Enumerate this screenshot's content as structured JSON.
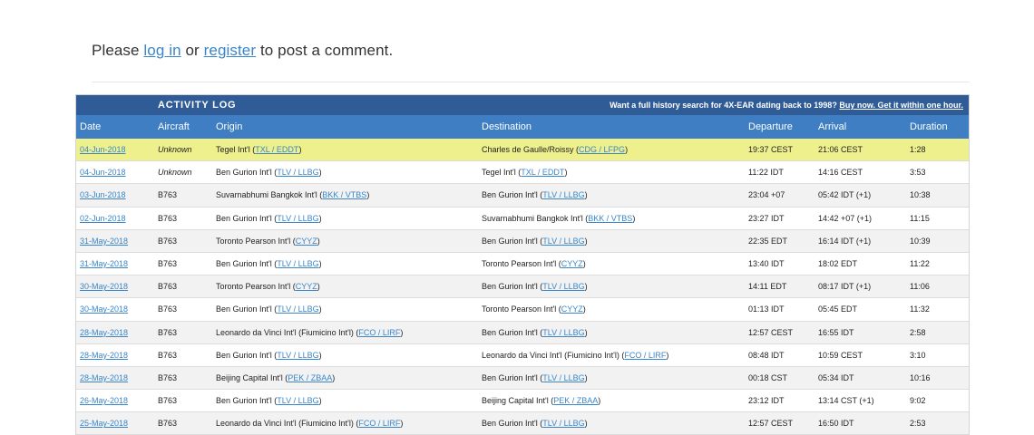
{
  "comment": {
    "prefix": "Please ",
    "login_label": "log in",
    "middle": " or ",
    "register_label": "register",
    "suffix": " to post a comment."
  },
  "activity_log": {
    "title": "ACTIVITY LOG",
    "promo_text": "Want a full history search for 4X-EAR dating back to 1998? ",
    "promo_link": "Buy now. Get it within one hour.",
    "columns": [
      "Date",
      "Aircraft",
      "Origin",
      "Destination",
      "Departure",
      "Arrival",
      "Duration"
    ],
    "rows": [
      {
        "date": "04-Jun-2018",
        "aircraft": "Unknown",
        "origin_name": "Tegel Int'l",
        "origin_code": "TXL / EDDT",
        "dest_name": "Charles de Gaulle/Roissy",
        "dest_code": "CDG / LFPG",
        "departure": "19:37 CEST",
        "arrival": "21:06 CEST",
        "duration": "1:28"
      },
      {
        "date": "04-Jun-2018",
        "aircraft": "Unknown",
        "origin_name": "Ben Gurion Int'l",
        "origin_code": "TLV / LLBG",
        "dest_name": "Tegel Int'l",
        "dest_code": "TXL / EDDT",
        "departure": "11:22 IDT",
        "arrival": "14:16 CEST",
        "duration": "3:53"
      },
      {
        "date": "03-Jun-2018",
        "aircraft": "B763",
        "origin_name": "Suvarnabhumi Bangkok Int'l",
        "origin_code": "BKK / VTBS",
        "dest_name": "Ben Gurion Int'l",
        "dest_code": "TLV / LLBG",
        "departure": "23:04 +07",
        "arrival": "05:42 IDT (+1)",
        "duration": "10:38"
      },
      {
        "date": "02-Jun-2018",
        "aircraft": "B763",
        "origin_name": "Ben Gurion Int'l",
        "origin_code": "TLV / LLBG",
        "dest_name": "Suvarnabhumi Bangkok Int'l",
        "dest_code": "BKK / VTBS",
        "departure": "23:27 IDT",
        "arrival": "14:42 +07 (+1)",
        "duration": "11:15"
      },
      {
        "date": "31-May-2018",
        "aircraft": "B763",
        "origin_name": "Toronto Pearson Int'l",
        "origin_code": "CYYZ",
        "dest_name": "Ben Gurion Int'l",
        "dest_code": "TLV / LLBG",
        "departure": "22:35 EDT",
        "arrival": "16:14 IDT (+1)",
        "duration": "10:39"
      },
      {
        "date": "31-May-2018",
        "aircraft": "B763",
        "origin_name": "Ben Gurion Int'l",
        "origin_code": "TLV / LLBG",
        "dest_name": "Toronto Pearson Int'l",
        "dest_code": "CYYZ",
        "departure": "13:40 IDT",
        "arrival": "18:02 EDT",
        "duration": "11:22"
      },
      {
        "date": "30-May-2018",
        "aircraft": "B763",
        "origin_name": "Toronto Pearson Int'l",
        "origin_code": "CYYZ",
        "dest_name": "Ben Gurion Int'l",
        "dest_code": "TLV / LLBG",
        "departure": "14:11 EDT",
        "arrival": "08:17 IDT (+1)",
        "duration": "11:06"
      },
      {
        "date": "30-May-2018",
        "aircraft": "B763",
        "origin_name": "Ben Gurion Int'l",
        "origin_code": "TLV / LLBG",
        "dest_name": "Toronto Pearson Int'l",
        "dest_code": "CYYZ",
        "departure": "01:13 IDT",
        "arrival": "05:45 EDT",
        "duration": "11:32"
      },
      {
        "date": "28-May-2018",
        "aircraft": "B763",
        "origin_name": "Leonardo da Vinci Int'l (Fiumicino Int'l)",
        "origin_code": "FCO / LIRF",
        "dest_name": "Ben Gurion Int'l",
        "dest_code": "TLV / LLBG",
        "departure": "12:57 CEST",
        "arrival": "16:55 IDT",
        "duration": "2:58"
      },
      {
        "date": "28-May-2018",
        "aircraft": "B763",
        "origin_name": "Ben Gurion Int'l",
        "origin_code": "TLV / LLBG",
        "dest_name": "Leonardo da Vinci Int'l (Fiumicino Int'l)",
        "dest_code": "FCO / LIRF",
        "departure": "08:48 IDT",
        "arrival": "10:59 CEST",
        "duration": "3:10"
      },
      {
        "date": "28-May-2018",
        "aircraft": "B763",
        "origin_name": "Beijing Capital Int'l",
        "origin_code": "PEK / ZBAA",
        "dest_name": "Ben Gurion Int'l",
        "dest_code": "TLV / LLBG",
        "departure": "00:18 CST",
        "arrival": "05:34 IDT",
        "duration": "10:16"
      },
      {
        "date": "26-May-2018",
        "aircraft": "B763",
        "origin_name": "Ben Gurion Int'l",
        "origin_code": "TLV / LLBG",
        "dest_name": "Beijing Capital Int'l",
        "dest_code": "PEK / ZBAA",
        "departure": "23:12 IDT",
        "arrival": "13:14 CST (+1)",
        "duration": "9:02"
      },
      {
        "date": "25-May-2018",
        "aircraft": "B763",
        "origin_name": "Leonardo da Vinci Int'l (Fiumicino Int'l)",
        "origin_code": "FCO / LIRF",
        "dest_name": "Ben Gurion Int'l",
        "dest_code": "TLV / LLBG",
        "departure": "12:57 CEST",
        "arrival": "16:50 IDT",
        "duration": "2:53"
      }
    ]
  }
}
